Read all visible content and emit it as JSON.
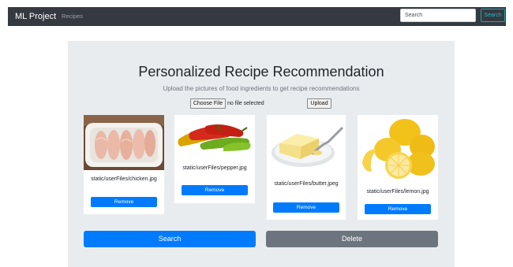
{
  "navbar": {
    "brand": "ML Project",
    "links": [
      "Recipes"
    ],
    "search_placeholder": "Search",
    "search_button": "Search"
  },
  "main": {
    "title": "Personalized Recipe Recommendation",
    "subtitle": "Upload the pictures of food ingredients to get recipe recommendations",
    "choose_file_label": "Choose File",
    "no_file_text": "no file selected",
    "upload_label": "Upload",
    "cards": [
      {
        "filename": "static/userFiles/chicken.jpg",
        "remove_label": "Remove",
        "image": "chicken-photo"
      },
      {
        "filename": "static/userFiles/pepper.jpg",
        "remove_label": "Remove",
        "image": "pepper-photo"
      },
      {
        "filename": "static/userFiles/butter.jpeg",
        "remove_label": "Remove",
        "image": "butter-photo"
      },
      {
        "filename": "static/userFiles/lemon.jpg",
        "remove_label": "Remove",
        "image": "lemon-photo"
      }
    ],
    "search_label": "Search",
    "delete_label": "Delete"
  },
  "colors": {
    "navbar_bg": "#343a40",
    "primary": "#007bff",
    "secondary": "#6c757d",
    "jumbotron_bg": "#e9ecef",
    "info": "#17a2b8"
  }
}
